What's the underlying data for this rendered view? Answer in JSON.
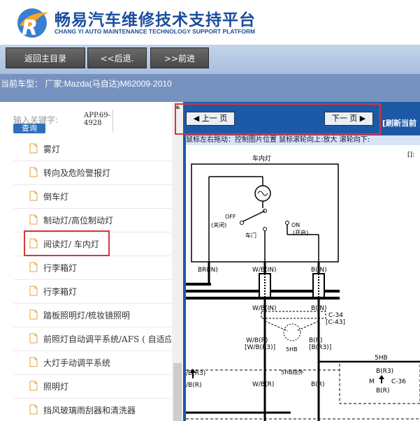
{
  "header": {
    "title": "畅易汽车维修技术支持平台",
    "subtitle": "CHANG YI AUTO MAINTENANCE TECHNOLOGY SUPPORT PLATFORM"
  },
  "nav": {
    "back_main": "返回主目录",
    "back": "<<后退.",
    "forward": ">>前进"
  },
  "model_line": "当前车型： 厂家:Mazda(马自达)M62009-2010",
  "search": {
    "label": "输入关键字:",
    "button": "查询",
    "app_code_line1": "APP.69-",
    "app_code_line2": "4928"
  },
  "tree": [
    "雾灯",
    "转向及危险警报灯",
    "倒车灯",
    "制动灯/高位制动灯",
    "阅读灯/ 车内灯",
    "行李箱灯",
    "行李箱灯",
    "踏板照明灯/梳妆镜照明",
    "前照灯自动调平系统/AFS ( 自适应",
    "大灯手动调平系统",
    "照明灯",
    "挡风玻璃雨刮器和清洗器"
  ],
  "selected_item": "阅读灯/ 车内灯",
  "viewer": {
    "prev": "上一 页",
    "next": "下一 页",
    "refresh": "[刷新当前",
    "hint": "鼠标左右拖动：控制图片位置 鼠标滚轮向上:放大  滚轮向下:",
    "diagram": {
      "title": "车内灯",
      "off": "OFF",
      "off_cn": "(关闭)",
      "on": "ON",
      "on_cn": "(开启)",
      "door": "车门",
      "br_in": "BR(IN)",
      "wb_in1": "W/B(IN)",
      "b_in1": "B(IN)",
      "wb_in2": "W/B(IN)",
      "b_in2": "B(IN)",
      "c34": "C-34",
      "c43": "[C-43]",
      "wbr": "W/B(R)",
      "wbr3": "[W/B(R3)]",
      "br": "B(R)",
      "br3": "[B(R3)]",
      "shb": "5HB",
      "shb2": "5HB",
      "shb_except": "5HB除外",
      "br3b": "B(R3)",
      "c36": "C-36",
      "m": "M",
      "brb": "B(R)",
      "br3_left": "/B(R3)",
      "br_left": "/B(R)",
      "wbr2": "W/B(R)",
      "br2": "B(R)",
      "corner": "[]:"
    }
  },
  "colors": {
    "brand_blue": "#1b4e9e",
    "navbar": "#a9bedf",
    "modelbar": "#7692bf",
    "viewer_bg": "#1c5aa8",
    "highlight_red": "#d9353a"
  }
}
